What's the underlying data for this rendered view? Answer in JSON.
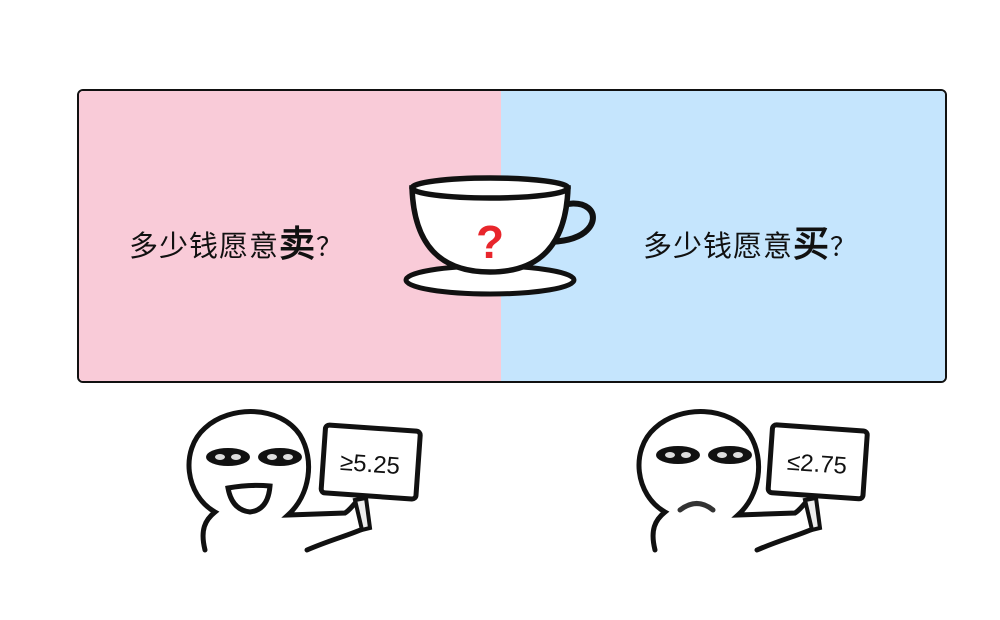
{
  "seller": {
    "question_prefix": "多少钱愿意",
    "question_verb": "卖",
    "question_mark": "？",
    "sign_text": "≥5.25",
    "mood": "happy"
  },
  "buyer": {
    "question_prefix": "多少钱愿意",
    "question_verb": "买",
    "question_mark": "？",
    "sign_text": "≤2.75",
    "mood": "sad"
  },
  "cup": {
    "symbol": "?"
  },
  "colors": {
    "seller_bg": "#F9CBD8",
    "buyer_bg": "#C5E5FD",
    "question_mark": "#E8262C"
  }
}
